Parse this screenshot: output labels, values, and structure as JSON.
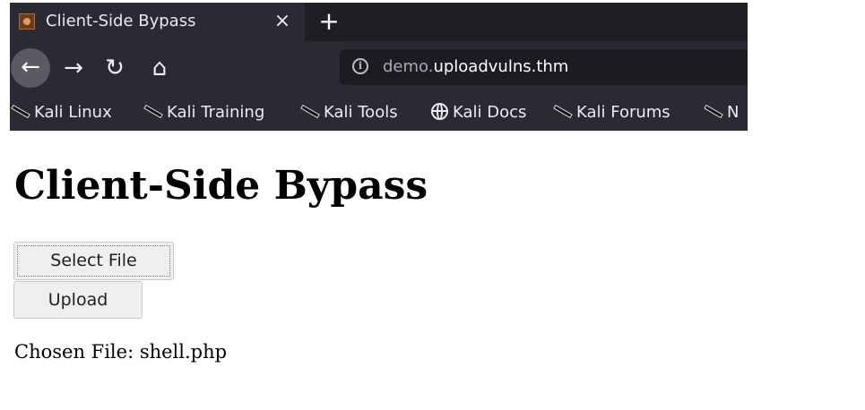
{
  "browser": {
    "tab": {
      "title": "Client-Side Bypass",
      "close_glyph": "×",
      "favicon": "site-favicon-icon"
    },
    "new_tab_glyph": "+",
    "nav": {
      "back_glyph": "←",
      "forward_glyph": "→",
      "reload_glyph": "↻",
      "home_glyph": "⌂"
    },
    "url": {
      "info_glyph": "i",
      "subdomain": "demo.",
      "domain": "uploadvulns.thm"
    },
    "bookmarks": [
      {
        "label": "Kali Linux",
        "icon": "kali-dragon-icon"
      },
      {
        "label": "Kali Training",
        "icon": "kali-dragon-icon"
      },
      {
        "label": "Kali Tools",
        "icon": "kali-dragon-icon"
      },
      {
        "label": "Kali Docs",
        "icon": "globe-icon"
      },
      {
        "label": "Kali Forums",
        "icon": "kali-dragon-icon"
      },
      {
        "label": "N",
        "icon": "kali-dragon-icon"
      }
    ]
  },
  "page": {
    "title": "Client-Side Bypass",
    "select_button": "Select File",
    "upload_button": "Upload",
    "chosen_file": "Chosen File: shell.php"
  },
  "colors": {
    "chrome_bg": "#2b2a33",
    "tabbar_bg": "#1f1e25",
    "urlbar_bg": "#1c1b22",
    "button_bg": "#efefef"
  }
}
